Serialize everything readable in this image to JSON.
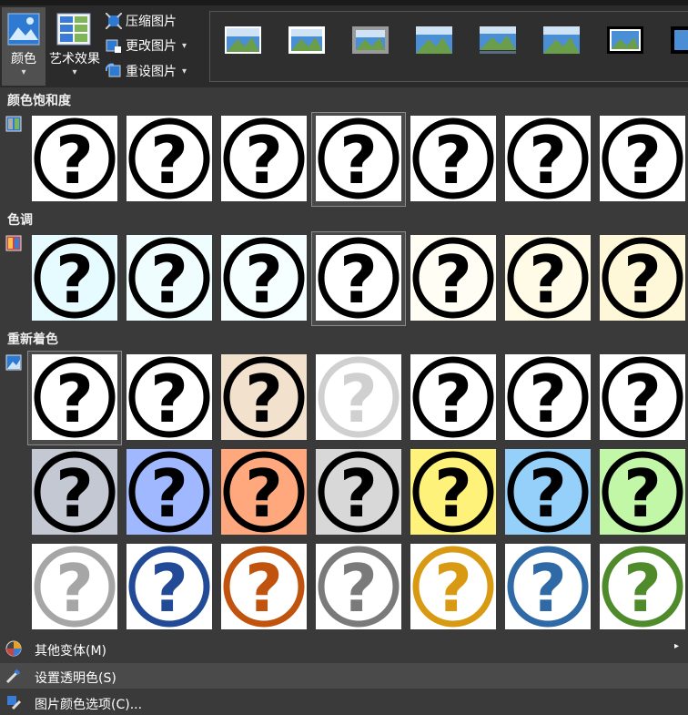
{
  "ribbon": {
    "color_label": "颜色",
    "artistic_label": "艺术效果",
    "compress_label": "压缩图片",
    "change_label": "更改图片",
    "reset_label": "重设图片"
  },
  "sections": {
    "saturation_title": "颜色饱和度",
    "tone_title": "色调",
    "recolor_title": "重新着色"
  },
  "saturation_tiles": [
    {
      "bg": "#ffffff",
      "ring": "#000000"
    },
    {
      "bg": "#ffffff",
      "ring": "#000000"
    },
    {
      "bg": "#ffffff",
      "ring": "#000000"
    },
    {
      "bg": "#ffffff",
      "ring": "#000000"
    },
    {
      "bg": "#ffffff",
      "ring": "#000000"
    },
    {
      "bg": "#ffffff",
      "ring": "#000000"
    },
    {
      "bg": "#ffffff",
      "ring": "#000000"
    }
  ],
  "tone_tiles": [
    {
      "bg": "#e6fbff",
      "ring": "#000000"
    },
    {
      "bg": "#effdff",
      "ring": "#000000"
    },
    {
      "bg": "#f6ffff",
      "ring": "#000000"
    },
    {
      "bg": "#ffffff",
      "ring": "#000000"
    },
    {
      "bg": "#fffdf4",
      "ring": "#000000"
    },
    {
      "bg": "#fffbe6",
      "ring": "#000000"
    },
    {
      "bg": "#fff8d8",
      "ring": "#000000"
    }
  ],
  "recolor_tiles": [
    {
      "bg": "#ffffff",
      "ring": "#000000"
    },
    {
      "bg": "#ffffff",
      "ring": "#000000"
    },
    {
      "bg": "#f2e1cd",
      "ring": "#000000"
    },
    {
      "bg": "#ffffff",
      "ring": "#d0d0d0"
    },
    {
      "bg": "#ffffff",
      "ring": "#000000"
    },
    {
      "bg": "#ffffff",
      "ring": "#000000"
    },
    {
      "bg": "#ffffff",
      "ring": "#000000"
    },
    {
      "bg": "#c3c8d3",
      "ring": "#000000"
    },
    {
      "bg": "#9fb8ff",
      "ring": "#000000"
    },
    {
      "bg": "#ffa87e",
      "ring": "#000000"
    },
    {
      "bg": "#d8d8d8",
      "ring": "#000000"
    },
    {
      "bg": "#fff27a",
      "ring": "#000000"
    },
    {
      "bg": "#95d0fb",
      "ring": "#000000"
    },
    {
      "bg": "#c2f7a8",
      "ring": "#000000"
    },
    {
      "bg": "#ffffff",
      "ring": "#a6a6a6"
    },
    {
      "bg": "#ffffff",
      "ring": "#234a96"
    },
    {
      "bg": "#ffffff",
      "ring": "#c0540e"
    },
    {
      "bg": "#ffffff",
      "ring": "#7a7a7a"
    },
    {
      "bg": "#ffffff",
      "ring": "#d89a12"
    },
    {
      "bg": "#ffffff",
      "ring": "#2f6aa6"
    },
    {
      "bg": "#ffffff",
      "ring": "#4f8a2b"
    }
  ],
  "menu": {
    "more_variations": "其他变体(M)",
    "set_transparent": "设置透明色(S)",
    "color_options": "图片颜色选项(C)..."
  },
  "tile_glyph": "?"
}
